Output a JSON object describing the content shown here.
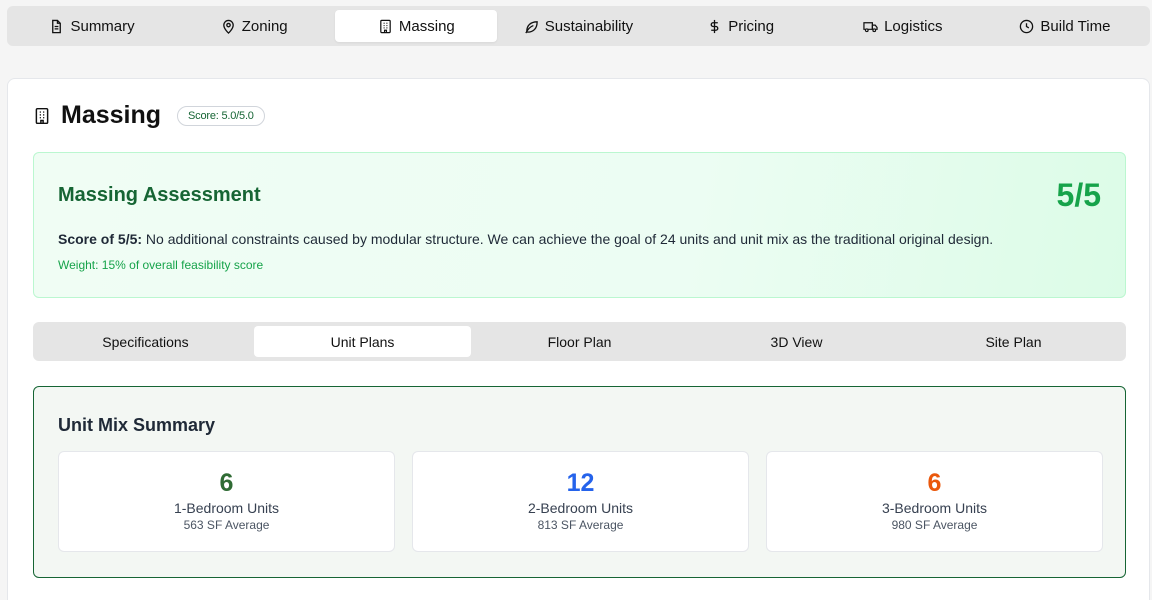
{
  "top_tabs": [
    {
      "label": "Summary",
      "icon": "document-icon",
      "active": false
    },
    {
      "label": "Zoning",
      "icon": "map-pin-icon",
      "active": false
    },
    {
      "label": "Massing",
      "icon": "building-icon",
      "active": true
    },
    {
      "label": "Sustainability",
      "icon": "leaf-icon",
      "active": false
    },
    {
      "label": "Pricing",
      "icon": "dollar-icon",
      "active": false
    },
    {
      "label": "Logistics",
      "icon": "truck-icon",
      "active": false
    },
    {
      "label": "Build Time",
      "icon": "clock-icon",
      "active": false
    }
  ],
  "section": {
    "title": "Massing",
    "score_badge": "Score: 5.0/5.0"
  },
  "assessment": {
    "title": "Massing Assessment",
    "score": "5/5",
    "score_label": "Score of 5/5:",
    "description": " No additional constraints caused by modular structure. We can achieve the goal of 24 units and unit mix as the traditional original design.",
    "weight": "Weight: 15% of overall feasibility score"
  },
  "sub_tabs": [
    {
      "label": "Specifications",
      "active": false
    },
    {
      "label": "Unit Plans",
      "active": true
    },
    {
      "label": "Floor Plan",
      "active": false
    },
    {
      "label": "3D View",
      "active": false
    },
    {
      "label": "Site Plan",
      "active": false
    }
  ],
  "unit_mix": {
    "title": "Unit Mix Summary",
    "cards": [
      {
        "count": "6",
        "label": "1-Bedroom Units",
        "sub": "563 SF Average",
        "color": "#2f6b34"
      },
      {
        "count": "12",
        "label": "2-Bedroom Units",
        "sub": "813 SF Average",
        "color": "#2563eb"
      },
      {
        "count": "6",
        "label": "3-Bedroom Units",
        "sub": "980 SF Average",
        "color": "#ea580c"
      }
    ]
  },
  "colors": {
    "accent_green": "#166534",
    "score_green": "#16a34a"
  }
}
